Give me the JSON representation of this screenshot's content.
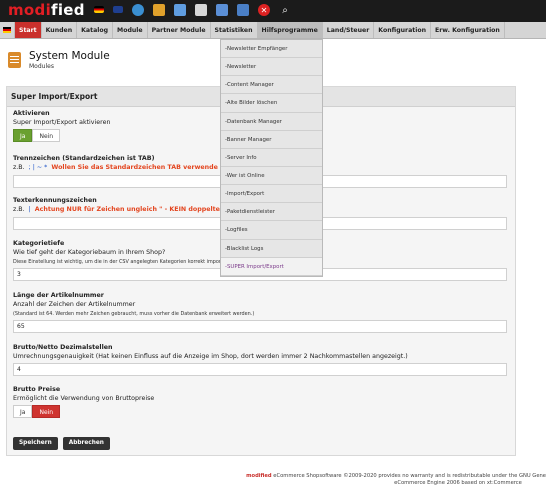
{
  "topbar": {
    "logo_main": "modi",
    "logo_rest": "fied",
    "icons": [
      "flag-de-icon",
      "flag-uk-icon",
      "globe-icon",
      "tools-icon",
      "stats-icon",
      "calendar-icon",
      "copy-icon",
      "settings-icon",
      "logout-icon",
      "search-icon"
    ]
  },
  "nav": {
    "items": [
      {
        "label": "Start",
        "active": true
      },
      {
        "label": "Kunden"
      },
      {
        "label": "Katalog"
      },
      {
        "label": "Module"
      },
      {
        "label": "Partner Module"
      },
      {
        "label": "Statistiken"
      },
      {
        "label": "Hilfsprogramme",
        "hover": true
      },
      {
        "label": "Land/Steuer"
      },
      {
        "label": "Konfiguration"
      },
      {
        "label": "Erw. Konfiguration"
      }
    ]
  },
  "dropdown": {
    "items": [
      "-Newsletter Empfänger",
      "-Newsletter",
      "-Content Manager",
      "-Alte Bilder löschen",
      "-Datenbank Manager",
      "-Banner Manager",
      "-Server Info",
      "-Wer ist Online",
      "-Import/Export",
      "-Paketdienstleister",
      "-Logfiles",
      "-Blacklist Logs",
      "-SUPER Import/Export"
    ],
    "selected": 12
  },
  "header": {
    "title": "System Module",
    "subtitle": "Modules"
  },
  "panel": {
    "title": "Super Import/Export",
    "activate": {
      "label": "Aktivieren",
      "desc": "Super Import/Export aktivieren",
      "yes": "Ja",
      "no": "Nein"
    },
    "separator": {
      "label": "Trennzeichen (Standardzeichen ist TAB)",
      "eg": "z.B.",
      "chars": "; | ~ *",
      "warn": "Wollen Sie das Standardzeichen TAB verwende",
      "value": ""
    },
    "text_id": {
      "label": "Texterkennungszeichen",
      "eg": "z.B.",
      "chars": "|",
      "warn": "Achtung NUR für Zeichen ungleich \" - KEIN doppeltes A",
      "value": ""
    },
    "cat_depth": {
      "label": "Kategorietiefe",
      "desc": "Wie tief geht der Kategoriebaum in Ihrem Shop?",
      "note": "Diese Einstellung ist wichtig, um die in der CSV angelegten Kategorien korrekt importieren und exportieren zu können.",
      "value": "3"
    },
    "art_len": {
      "label": "Länge der Artikelnummer",
      "desc": "Anzahl der Zeichen der Artikelnummer",
      "note": "(Standard ist 64. Werden mehr Zeichen gebraucht, muss vorher die Datenbank erweitert werden.)",
      "value": "65"
    },
    "decimals": {
      "label": "Brutto/Netto Dezimalstellen",
      "desc": "Umrechnungsgenauigkeit (Hat keinen Einfluss auf die Anzeige im Shop, dort werden immer 2 Nachkommastellen angezeigt.)",
      "value": "4"
    },
    "gross": {
      "label": "Brutto Preise",
      "desc": "Ermöglicht die Verwendung von Bruttopreise",
      "yes": "Ja",
      "no": "Nein"
    },
    "save": "Speichern",
    "cancel": "Abbrechen"
  },
  "footer": {
    "brand": "modified",
    "line1": " eCommerce Shopsoftware ©2009-2020 provides no warranty and is redistributable under the GNU Gene",
    "line2": "eCommerce Engine 2006 based on xt:Commerce"
  },
  "colors": {
    "active_nav": "#c9302c",
    "toggle_on_yes": "#6aa030",
    "toggle_on_no": "#cf3430",
    "warn": "#e3451f"
  }
}
